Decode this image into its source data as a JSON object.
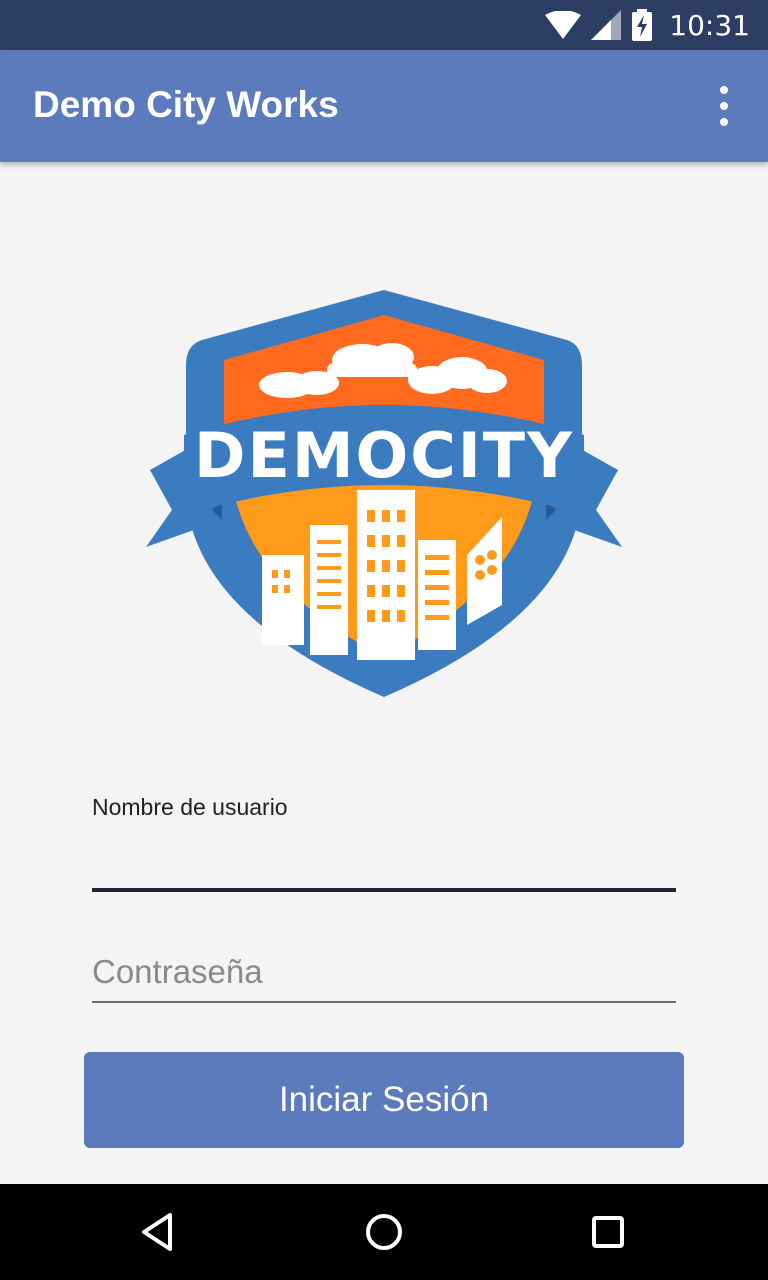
{
  "status_bar": {
    "time": "10:31",
    "icons": [
      "wifi-icon",
      "cell-signal-icon",
      "battery-charging-icon"
    ]
  },
  "app_bar": {
    "title": "Demo City Works",
    "menu_icon": "more-vert-icon"
  },
  "logo": {
    "text": "DEMOCITY",
    "colors": {
      "shield": "#3b7bbf",
      "sky": "#ff6a1f",
      "city": "#ff9a1a",
      "buildings": "#ffffff"
    }
  },
  "login_form": {
    "username_label": "Nombre de usuario",
    "username_value": "",
    "password_placeholder": "Contraseña",
    "password_value": "",
    "submit_label": "Iniciar Sesión"
  },
  "nav_bar": {
    "icons": [
      "back-icon",
      "home-icon",
      "recents-icon"
    ]
  },
  "colors": {
    "status_bar": "#2c3e63",
    "accent": "#5b7bbd",
    "background": "#f4f4f4"
  }
}
